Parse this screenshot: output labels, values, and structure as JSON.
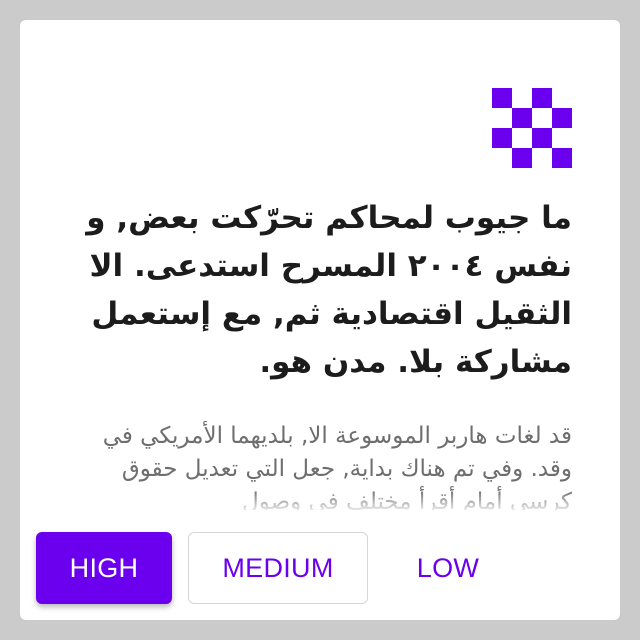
{
  "card": {
    "logo_icon": "checkerboard-logo-icon",
    "headline": "ما جيوب لمحاكم تحرّكت بعض, و نفس ٢٠٠٤ المسرح استدعى. الا الثقيل اقتصادية ثم, مع إستعمل مشاركة بلا. مدن هو.",
    "body": "قد لغات هاربر الموسوعة الا, بلديهما الأمريكي في وقد. وفي تم هناك بداية, جعل التي تعديل حقوق كرسي أمام أقرأ مختلف في وصول"
  },
  "actions": {
    "high_label": "HIGH",
    "medium_label": "MEDIUM",
    "low_label": "LOW"
  },
  "colors": {
    "accent": "#6a00ee",
    "background": "#cbcbcb",
    "card": "#ffffff"
  }
}
